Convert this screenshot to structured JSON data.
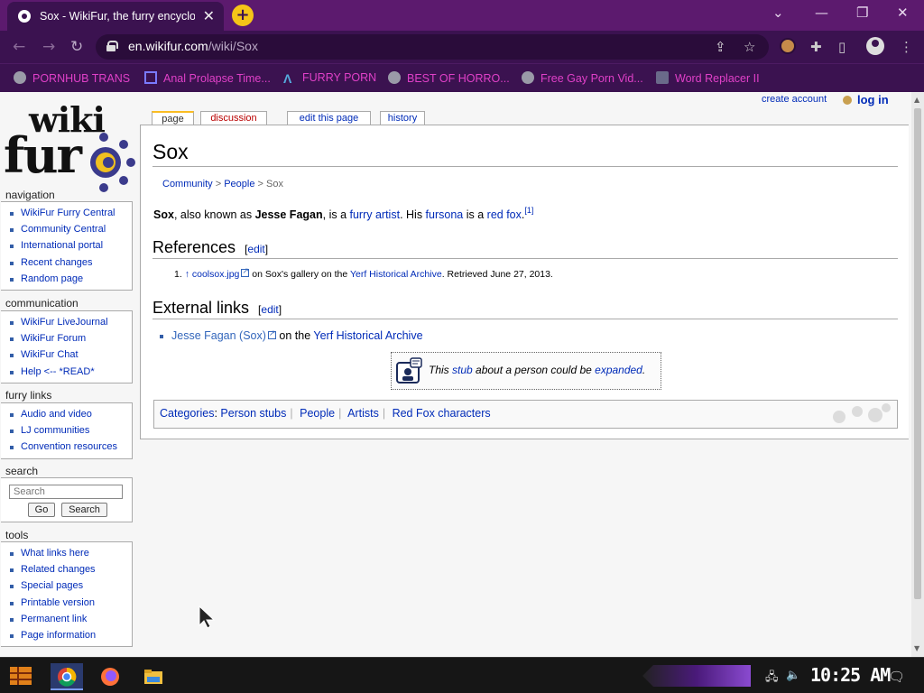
{
  "browser": {
    "tab_title": "Sox - WikiFur, the furry encyclopedia",
    "url_domain": "en.wikifur.com",
    "url_path": "/wiki/Sox",
    "bookmarks": [
      {
        "label": "PORNHUB TRANS"
      },
      {
        "label": "Anal Prolapse Time..."
      },
      {
        "label": "FURRY PORN"
      },
      {
        "label": "BEST OF HORRO..."
      },
      {
        "label": "Free Gay Porn Vid..."
      },
      {
        "label": "Word Replacer II"
      }
    ],
    "accent_color": "#3b1250"
  },
  "logo": {
    "top": "wiki",
    "bottom": "fur"
  },
  "personal": {
    "create_account": "create account",
    "login": "log in"
  },
  "tabs": [
    {
      "label": "page"
    },
    {
      "label": "discussion"
    },
    {
      "label": "edit this page"
    },
    {
      "label": "history"
    }
  ],
  "sidebar": {
    "navigation": {
      "heading": "navigation",
      "items": [
        "WikiFur Furry Central",
        "Community Central",
        "International portal",
        "Recent changes",
        "Random page"
      ]
    },
    "communication": {
      "heading": "communication",
      "items": [
        "WikiFur LiveJournal",
        "WikiFur Forum",
        "WikiFur Chat",
        "Help <-- *READ*"
      ]
    },
    "furry_links": {
      "heading": "furry links",
      "items": [
        "Audio and video",
        "LJ communities",
        "Convention resources"
      ]
    },
    "search": {
      "heading": "search",
      "placeholder": "Search",
      "go": "Go",
      "search": "Search"
    },
    "tools": {
      "heading": "tools",
      "items": [
        "What links here",
        "Related changes",
        "Special pages",
        "Printable version",
        "Permanent link",
        "Page information"
      ]
    }
  },
  "article": {
    "title": "Sox",
    "breadcrumb": {
      "c1": "Community",
      "c2": "People",
      "current": "Sox",
      "sep": ">"
    },
    "intro": {
      "name": "Sox",
      "t1": ", also known as ",
      "alias": "Jesse Fagan",
      "t2": ", is a ",
      "link1": "furry artist",
      "t3": ". His ",
      "link2": "fursona",
      "t4": " is a ",
      "link3": "red fox",
      "t5": ".",
      "ref": "[1]"
    },
    "references": {
      "heading": "References",
      "edit": "[edit]",
      "item_num": "1.",
      "item_arrow": "↑",
      "item_link": "coolsox.jpg",
      "item_t1": " on Sox's gallery on the ",
      "item_link2": "Yerf Historical Archive",
      "item_t2": ". Retrieved June 27, 2013."
    },
    "external": {
      "heading": "External links",
      "edit": "[edit]",
      "link": "Jesse Fagan (Sox)",
      "t1": " on the ",
      "link2": "Yerf Historical Archive"
    },
    "stub": {
      "t1": "This ",
      "link1": "stub",
      "t2": " about a person could be ",
      "link2": "expanded",
      "t3": "."
    },
    "categories": {
      "label": "Categories",
      "colon": ":",
      "items": [
        "Person stubs",
        "People",
        "Artists",
        "Red Fox characters"
      ]
    }
  },
  "taskbar": {
    "time": "10:25 AM"
  }
}
